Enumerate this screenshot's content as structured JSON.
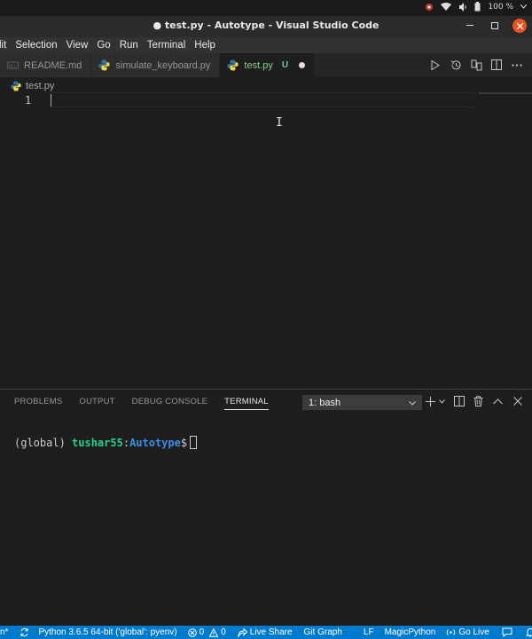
{
  "system_tray": {
    "battery": "100 %",
    "icons": [
      "indicator-icon",
      "wifi-icon",
      "volume-icon",
      "battery-icon",
      "chevron-down-icon"
    ]
  },
  "window": {
    "title": "● test.py - Autotype - Visual Studio Code",
    "controls": [
      "minimize",
      "maximize",
      "close"
    ]
  },
  "menu": {
    "items": [
      "lit",
      "Selection",
      "View",
      "Go",
      "Run",
      "Terminal",
      "Help"
    ]
  },
  "tabs": [
    {
      "label": "README.md",
      "icon": "markdown-icon",
      "active": false
    },
    {
      "label": "simulate_keyboard.py",
      "icon": "python-icon",
      "active": false
    },
    {
      "label": "test.py",
      "icon": "python-icon",
      "active": true,
      "status": "U"
    }
  ],
  "breadcrumb": {
    "file": "test.py"
  },
  "editor": {
    "line_number": "1",
    "content": ""
  },
  "panel": {
    "tabs": [
      "PROBLEMS",
      "OUTPUT",
      "DEBUG CONSOLE",
      "TERMINAL"
    ],
    "active_tab": "TERMINAL",
    "terminal_select": "1: bash",
    "prompt": {
      "env": "(global) ",
      "user": "tushar55",
      "sep": ":",
      "dir": "Autotype",
      "suffix": "$"
    }
  },
  "statusbar": {
    "left_fragment": "n*",
    "python": "Python 3.6.5 64-bit ('global': pyenv)",
    "errors": "0",
    "warnings": "0",
    "live_share": "Live Share",
    "git_graph": "Git Graph",
    "eol": "LF",
    "language": "MagicPython",
    "go_live": "Go Live"
  },
  "colors": {
    "accent": "#007acc",
    "terminal_user": "#23d18b",
    "terminal_dir": "#3b8eea",
    "close_button": "#e95420"
  }
}
